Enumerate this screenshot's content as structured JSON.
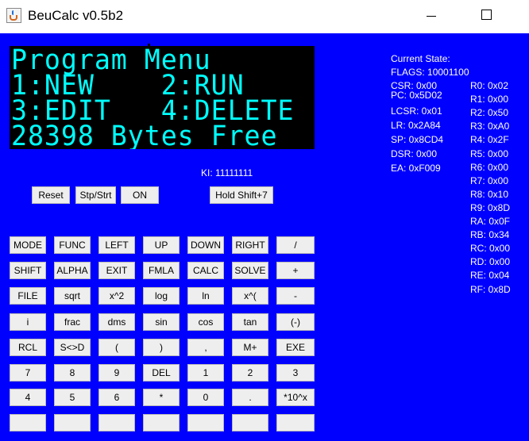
{
  "window": {
    "title": "BeuCalc v0.5b2"
  },
  "lcd": {
    "lines": [
      "Program Menu",
      "1:NEW    2:RUN",
      "3:EDIT   4:DELETE",
      "28398 Bytes Free"
    ]
  },
  "ki": "KI: 11111111",
  "control_buttons": [
    "Reset",
    "Stp/Strt",
    "ON",
    "Hold Shift+7"
  ],
  "keypad": [
    [
      "MODE",
      "FUNC",
      "LEFT",
      "UP",
      "DOWN",
      "RIGHT",
      "/"
    ],
    [
      "SHIFT",
      "ALPHA",
      "EXIT",
      "FMLA",
      "CALC",
      "SOLVE",
      "+"
    ],
    [
      "FILE",
      "sqrt",
      "x^2",
      "log",
      "ln",
      "x^(",
      "-"
    ],
    [
      "i",
      "frac",
      "dms",
      "sin",
      "cos",
      "tan",
      "(-)"
    ],
    [
      "RCL",
      "S<>D",
      "(",
      ")",
      ",",
      "M+",
      "EXE"
    ],
    [
      "7",
      "8",
      "9",
      "DEL",
      "1",
      "2",
      "3"
    ],
    [
      "4",
      "5",
      "6",
      "*",
      "0",
      ".",
      "*10^x"
    ],
    [
      "",
      "",
      "",
      "",
      "",
      "",
      ""
    ]
  ],
  "state": {
    "header": "Current State:",
    "flags": "FLAGS: 10001100",
    "left": [
      "CSR: 0x00",
      "PC: 0x5D02",
      "LCSR: 0x01",
      "LR: 0x2A84",
      "SP: 0x8CD4",
      "DSR: 0x00",
      "EA: 0xF009"
    ],
    "registers": [
      "R0: 0x02",
      "R1: 0x00",
      "R2: 0x50",
      "R3: 0xA0",
      "R4: 0x2F",
      "R5: 0x00",
      "R6: 0x00",
      "R7: 0x00",
      "R8: 0x10",
      "R9: 0x8D",
      "RA: 0x0F",
      "RB: 0x34",
      "RC: 0x00",
      "RD: 0x00",
      "RE: 0x04",
      "RF: 0x8D"
    ]
  }
}
